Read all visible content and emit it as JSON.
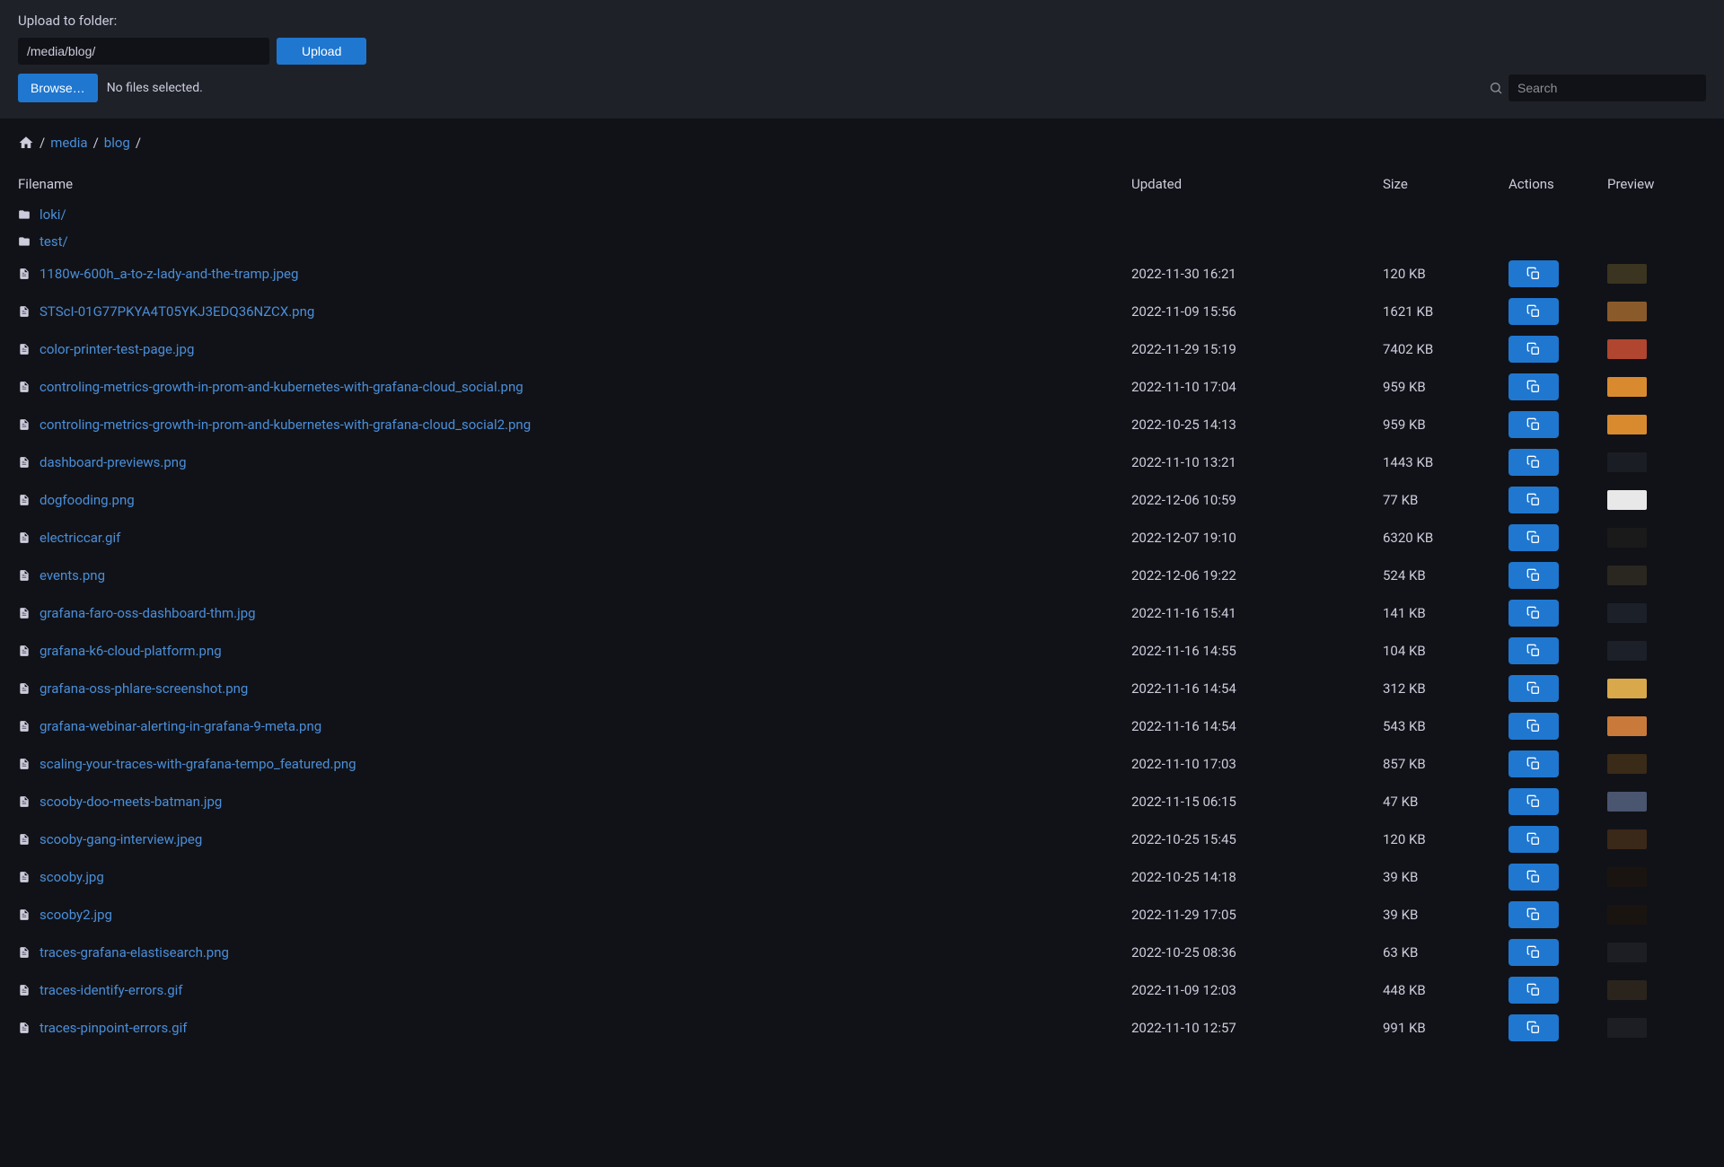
{
  "upload": {
    "label": "Upload to folder:",
    "path": "/media/blog/",
    "upload_button": "Upload",
    "browse_button": "Browse…",
    "no_files": "No files selected."
  },
  "search": {
    "placeholder": "Search"
  },
  "breadcrumb": {
    "parts": [
      "media",
      "blog"
    ]
  },
  "headers": {
    "filename": "Filename",
    "updated": "Updated",
    "size": "Size",
    "actions": "Actions",
    "preview": "Preview"
  },
  "folders": [
    {
      "name": "loki/"
    },
    {
      "name": "test/"
    }
  ],
  "files": [
    {
      "name": "1180w-600h_a-to-z-lady-and-the-tramp.jpeg",
      "updated": "2022-11-30 16:21",
      "size": "120 KB",
      "thumb": "#3a3420"
    },
    {
      "name": "STScI-01G77PKYA4T05YKJ3EDQ36NZCX.png",
      "updated": "2022-11-09 15:56",
      "size": "1621 KB",
      "thumb": "#8b5a2b"
    },
    {
      "name": "color-printer-test-page.jpg",
      "updated": "2022-11-29 15:19",
      "size": "7402 KB",
      "thumb": "#b04530"
    },
    {
      "name": "controling-metrics-growth-in-prom-and-kubernetes-with-grafana-cloud_social.png",
      "updated": "2022-11-10 17:04",
      "size": "959 KB",
      "thumb": "#d98a2e"
    },
    {
      "name": "controling-metrics-growth-in-prom-and-kubernetes-with-grafana-cloud_social2.png",
      "updated": "2022-10-25 14:13",
      "size": "959 KB",
      "thumb": "#d98a2e"
    },
    {
      "name": "dashboard-previews.png",
      "updated": "2022-11-10 13:21",
      "size": "1443 KB",
      "thumb": "#1a1d24"
    },
    {
      "name": "dogfooding.png",
      "updated": "2022-12-06 10:59",
      "size": "77 KB",
      "thumb": "#e8e8e8"
    },
    {
      "name": "electriccar.gif",
      "updated": "2022-12-07 19:10",
      "size": "6320 KB",
      "thumb": "#1a1a1a"
    },
    {
      "name": "events.png",
      "updated": "2022-12-06 19:22",
      "size": "524 KB",
      "thumb": "#2a2620"
    },
    {
      "name": "grafana-faro-oss-dashboard-thm.jpg",
      "updated": "2022-11-16 15:41",
      "size": "141 KB",
      "thumb": "#1c2028"
    },
    {
      "name": "grafana-k6-cloud-platform.png",
      "updated": "2022-11-16 14:55",
      "size": "104 KB",
      "thumb": "#1c2028"
    },
    {
      "name": "grafana-oss-phlare-screenshot.png",
      "updated": "2022-11-16 14:54",
      "size": "312 KB",
      "thumb": "#d9a84a"
    },
    {
      "name": "grafana-webinar-alerting-in-grafana-9-meta.png",
      "updated": "2022-11-16 14:54",
      "size": "543 KB",
      "thumb": "#c97a3a"
    },
    {
      "name": "scaling-your-traces-with-grafana-tempo_featured.png",
      "updated": "2022-11-10 17:03",
      "size": "857 KB",
      "thumb": "#3a2a18"
    },
    {
      "name": "scooby-doo-meets-batman.jpg",
      "updated": "2022-11-15 06:15",
      "size": "47 KB",
      "thumb": "#4a5570"
    },
    {
      "name": "scooby-gang-interview.jpeg",
      "updated": "2022-10-25 15:45",
      "size": "120 KB",
      "thumb": "#3a2818"
    },
    {
      "name": "scooby.jpg",
      "updated": "2022-10-25 14:18",
      "size": "39 KB",
      "thumb": "#1a1410"
    },
    {
      "name": "scooby2.jpg",
      "updated": "2022-11-29 17:05",
      "size": "39 KB",
      "thumb": "#1a1410"
    },
    {
      "name": "traces-grafana-elastisearch.png",
      "updated": "2022-10-25 08:36",
      "size": "63 KB",
      "thumb": "#1c1e24"
    },
    {
      "name": "traces-identify-errors.gif",
      "updated": "2022-11-09 12:03",
      "size": "448 KB",
      "thumb": "#2a241c"
    },
    {
      "name": "traces-pinpoint-errors.gif",
      "updated": "2022-11-10 12:57",
      "size": "991 KB",
      "thumb": "#1c1e24"
    }
  ]
}
